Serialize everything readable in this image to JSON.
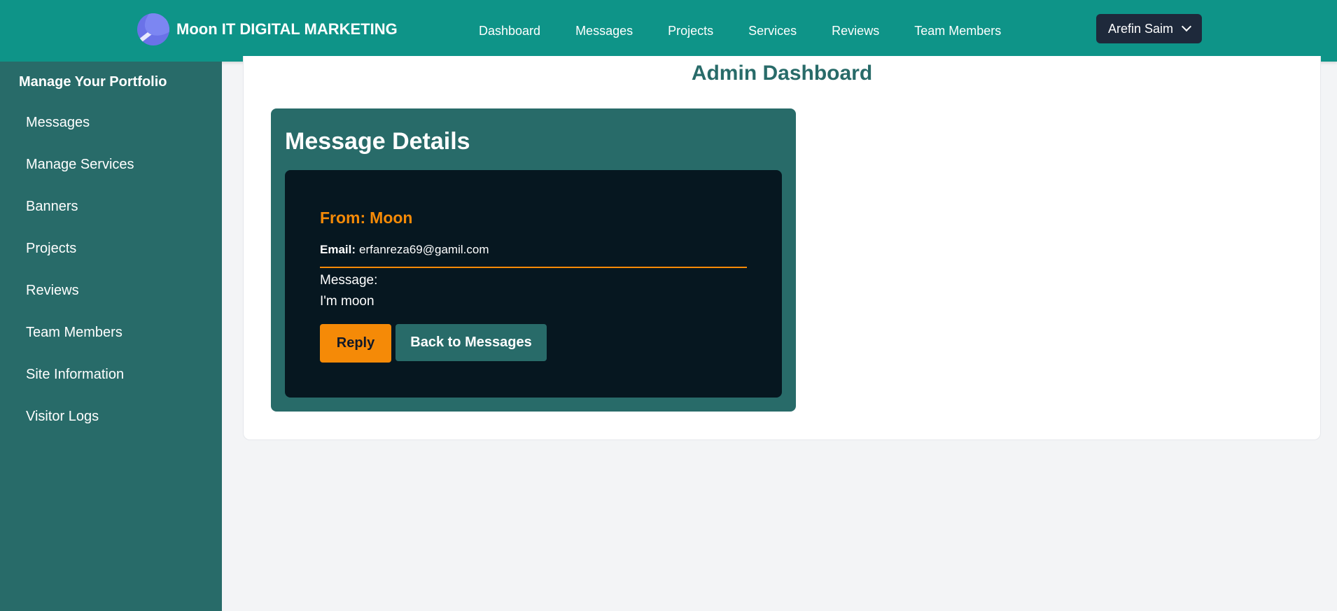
{
  "brand": {
    "name": "Moon IT DIGITAL MARKETING",
    "logo_icon": "moon-planet-logo"
  },
  "nav": {
    "items": [
      "Dashboard",
      "Messages",
      "Projects",
      "Services",
      "Reviews",
      "Team Members"
    ]
  },
  "user": {
    "name": "Arefin Saim",
    "dropdown_icon": "chevron-down-icon"
  },
  "sidebar": {
    "title": "Manage Your Portfolio",
    "items": [
      "Messages",
      "Manage Services",
      "Banners",
      "Projects",
      "Reviews",
      "Team Members",
      "Site Information",
      "Visitor Logs"
    ]
  },
  "page": {
    "title": "Admin Dashboard"
  },
  "message": {
    "card_title": "Message Details",
    "from_label": "From:",
    "from_name": "Moon",
    "email_label": "Email:",
    "email": "erfanreza69@gamil.com",
    "message_label": "Message:",
    "body": "I'm moon",
    "reply_label": "Reply",
    "back_label": "Back to Messages"
  },
  "colors": {
    "topbar": "#0e9488",
    "sidebar": "#286b69",
    "accent": "#f58a07",
    "inner_panel": "#061720"
  }
}
